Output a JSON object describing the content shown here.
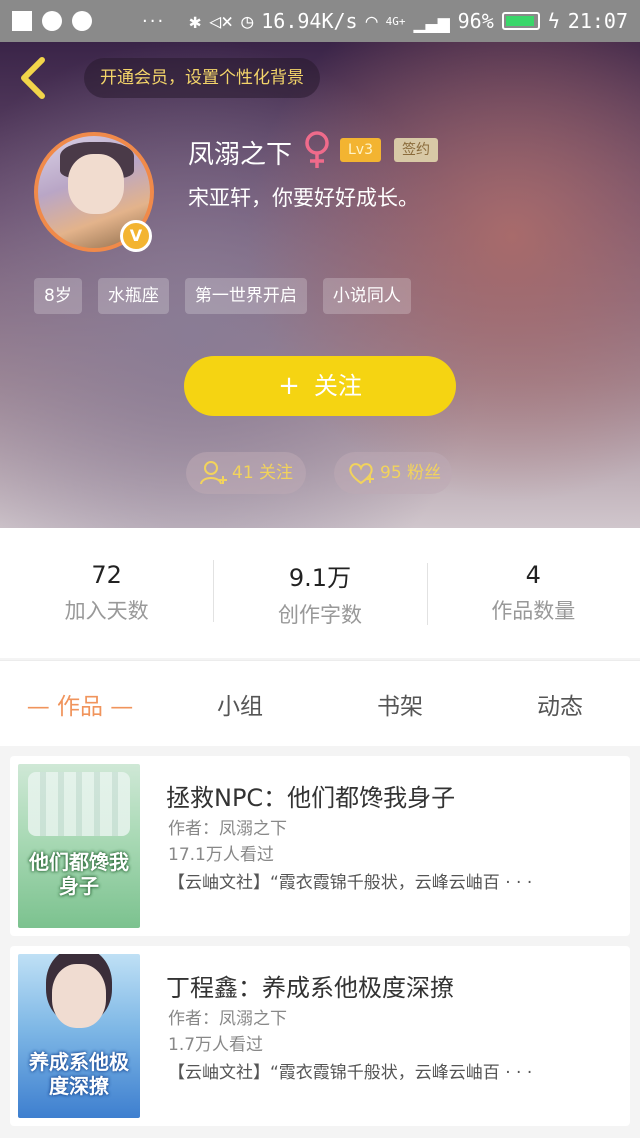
{
  "status_bar": {
    "network_speed": "16.94K/s",
    "network_type": "4G+",
    "battery": "96%",
    "time": "21:07",
    "icons": [
      "bluetooth-icon",
      "mute-icon",
      "alarm-icon",
      "wifi-icon",
      "signal-icon",
      "battery-icon",
      "charging-icon"
    ]
  },
  "header": {
    "vip_banner": "开通会员，设置个性化背景",
    "username": "凤溺之下",
    "level": "Lv3",
    "signed": "签约",
    "motto": "宋亚轩，你要好好成长。",
    "badge": "V",
    "tags": [
      "8岁",
      "水瓶座",
      "第一世界开启",
      "小说同人"
    ],
    "follow_button": "关注",
    "follow_plus": "+",
    "following": "41 关注",
    "fans": "95 粉丝"
  },
  "stats": [
    {
      "value": "72",
      "label": "加入天数"
    },
    {
      "value": "9.1万",
      "label": "创作字数"
    },
    {
      "value": "4",
      "label": "作品数量"
    }
  ],
  "tabs": [
    "— 作品 —",
    "小组",
    "书架",
    "动态"
  ],
  "works": [
    {
      "title": "拯救NPC：他们都馋我身子",
      "author": "作者：凤溺之下",
      "views": "17.1万人看过",
      "desc": "【云岫文社】“霞衣霞锦千般状，云峰云岫百 · · ·",
      "cover_text": "他们都馋我身子"
    },
    {
      "title": "丁程鑫：养成系他极度深撩",
      "author": "作者：凤溺之下",
      "views": "1.7万人看过",
      "desc": "【云岫文社】“霞衣霞锦千般状，云峰云岫百 · · ·",
      "cover_text": "养成系他极度深撩"
    }
  ],
  "colors": {
    "accent_yellow": "#f5d412",
    "tab_active": "#f0945c",
    "level_badge": "#f3b431"
  }
}
